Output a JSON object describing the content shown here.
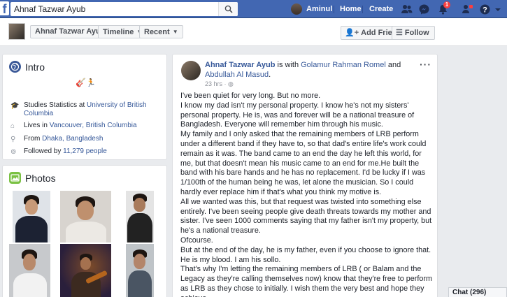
{
  "topbar": {
    "logo": "f",
    "search_value": "Ahnaf Tazwar Ayub",
    "user_name": "Aminul",
    "home_label": "Home",
    "create_label": "Create",
    "notifications_badge": "1",
    "brand_color": "#4267b2"
  },
  "subheader": {
    "name_button": "Ahnaf Tazwar Ayub",
    "timeline_button": "Timeline",
    "recent_button": "Recent",
    "add_friend_label": "Add Friend",
    "follow_label": "Follow"
  },
  "intro": {
    "title": "Intro",
    "items": [
      {
        "prefix": "Studies Statistics at ",
        "link": "University of British Columbia",
        "icon": "graduation-cap-icon"
      },
      {
        "prefix": "Lives in ",
        "link": "Vancouver, British Columbia",
        "icon": "home-icon"
      },
      {
        "prefix": "From ",
        "link": "Dhaka, Bangladesh",
        "icon": "location-pin-icon"
      },
      {
        "prefix": "Followed by ",
        "link": "11,279 people",
        "icon": "rss-icon"
      }
    ]
  },
  "photos": {
    "title": "Photos"
  },
  "post": {
    "author": "Ahnaf Tazwar Ayub",
    "with_text": " is with ",
    "tagged_1": "Golamur Rahman Romel",
    "and_text": " and ",
    "tagged_2": "Abdullah Al Masud",
    "period": ".",
    "time": "23 hrs",
    "paragraphs": [
      "I've been quiet for very long. But no more.",
      "I know my dad isn't my personal property. I know he's not my sisters' personal property. He is, was and forever will be a national treasure of Bangladesh. Everyone will remember him through his music.",
      "My family and I only asked that the remaining members of LRB perform under a different band if they have to, so that dad's entire life's work could remain as it was. The band came to an end the day he left this world, for me, but that doesn't mean his music came to an end for me.He built the band with his bare hands and he has no replacement. I'd be lucky if I was 1/100th of the human being he was, let alone the musician. So I could hardly ever replace him if that's what you think my motive is.",
      "All we wanted was this, but that request was twisted into something else entirely. I've been seeing people give death threats towards my mother and sister. I've seen 1000 comments saying that my father isn't my property, but he's a national treasure.",
      "Ofcourse.",
      "But at the end of the day, he is my father, even if you choose to ignore that. He is my blood. I am his sollo.",
      "That's why I'm letting the remaining members of LRB ( or Balam and the Legacy as they're calling themselves now) know that they're free to perform as LRB as they chose to initially. I wish them the very best and hope they achieve"
    ]
  },
  "chat": {
    "label": "Chat (296)"
  }
}
